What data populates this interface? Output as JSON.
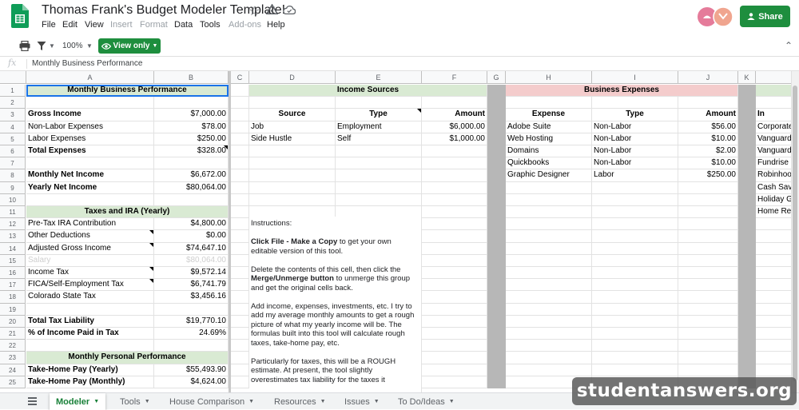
{
  "title": "Thomas Frank's Budget Modeler Template!",
  "menu": [
    "File",
    "Edit",
    "View",
    "Insert",
    "Format",
    "Data",
    "Tools",
    "Add-ons",
    "Help"
  ],
  "menu_dimmed": [
    "Insert",
    "Format",
    "Add-ons"
  ],
  "share_label": "Share",
  "toolbar": {
    "zoom": "100%",
    "view_only": "View only"
  },
  "formula_bar": {
    "content": "Monthly Business Performance"
  },
  "columns": [
    "A",
    "B",
    "C",
    "D",
    "E",
    "F",
    "G",
    "H",
    "I",
    "J",
    "K"
  ],
  "rows": [
    "1",
    "2",
    "3",
    "4",
    "5",
    "6",
    "7",
    "8",
    "9",
    "10",
    "11",
    "12",
    "13",
    "14",
    "15",
    "16",
    "17",
    "18",
    "19",
    "20",
    "21",
    "22",
    "23",
    "24",
    "25"
  ],
  "cells": {
    "a1": "Monthly Business Performance",
    "a3": "Gross Income",
    "b3": "$7,000.00",
    "a4": "Non-Labor Expenses",
    "b4": "$78.00",
    "a5": "Labor Expenses",
    "b5": "$250.00",
    "a6": "Total Expenses",
    "b6": "$328.00",
    "a8": "Monthly Net Income",
    "b8": "$6,672.00",
    "a9": "Yearly Net Income",
    "b9": "$80,064.00",
    "a11": "Taxes and IRA (Yearly)",
    "a12": "Pre-Tax IRA Contribution",
    "b12": "$4,800.00",
    "a13": "Other Deductions",
    "b13": "$0.00",
    "a14": "Adjusted Gross Income",
    "b14": "$74,647.10",
    "a15": "Salary",
    "b15": "$80,064.00",
    "a16": "Income Tax",
    "b16": "$9,572.14",
    "a17": "FICA/Self-Employment Tax",
    "b17": "$6,741.79",
    "a18": "Colorado State Tax",
    "b18": "$3,456.16",
    "a20": "Total Tax Liability",
    "b20": "$19,770.10",
    "a21": "% of Income Paid in Tax",
    "b21": "24.69%",
    "a23": "Monthly Personal Performance",
    "a24": "Take-Home Pay (Yearly)",
    "b24": "$55,493.90",
    "a25": "Take-Home Pay (Monthly)",
    "b25": "$4,624.00",
    "d1": "Income Sources",
    "d3": "Source",
    "e3": "Type",
    "f3": "Amount",
    "d4": "Job",
    "e4": "Employment",
    "f4": "$6,000.00",
    "d5": "Side Hustle",
    "e5": "Self",
    "f5": "$1,000.00",
    "h1": "Business Expenses",
    "h3": "Expense",
    "i3": "Type",
    "j3": "Amount",
    "h4": "Adobe Suite",
    "i4": "Non-Labor",
    "j4": "$56.00",
    "h5": "Web Hosting",
    "i5": "Non-Labor",
    "j5": "$10.00",
    "h6": "Domains",
    "i6": "Non-Labor",
    "j6": "$2.00",
    "h7": "Quickbooks",
    "i7": "Non-Labor",
    "j7": "$10.00",
    "h8": "Graphic Designer",
    "i8": "Labor",
    "j8": "$250.00",
    "l3": "In",
    "l4": "Corporate",
    "l5": "Vanguard",
    "l6": "Vanguard",
    "l7": "Fundrise",
    "l8": "Robinhood",
    "l9": "Cash Savi",
    "l10": "Holiday Gi",
    "l11": "Home Rep"
  },
  "instructions": {
    "heading": "Instructions:",
    "p1_bold": "Click File - Make a Copy",
    "p1_rest": " to get your own editable version of this tool.",
    "p2_start": "Delete the contents of this cell, then click the ",
    "p2_bold": "Merge/Unmerge button",
    "p2_rest": " to unmerge this group and get the original cells back.",
    "p3": "Add income, expenses, investments, etc. I try to add my average monthly amounts to get a rough picture of what my yearly income will be. The formulas built into this tool will calculate rough taxes, take-home pay, etc.",
    "p4": "Particularly for taxes, this will be a ROUGH estimate. At present, the tool slightly overestimates tax liability for the taxes it"
  },
  "sheet_tabs": [
    "Modeler",
    "Tools",
    "House Comparison",
    "Resources",
    "Issues",
    "To Do/Ideas"
  ],
  "active_tab": "Modeler",
  "watermark": "studentanswers.org",
  "colors": {
    "accent_green": "#1e8e3e",
    "header_green": "#d9ead3",
    "header_red": "#f4cccc",
    "gutter_grey": "#b7b7b7",
    "selection_blue": "#1a73e8"
  },
  "icons": [
    "sheets-logo",
    "star-icon",
    "move-to-folder-icon",
    "cloud-status-icon",
    "print-icon",
    "filter-icon",
    "eye-icon",
    "collapse-icon",
    "all-sheets-icon"
  ]
}
